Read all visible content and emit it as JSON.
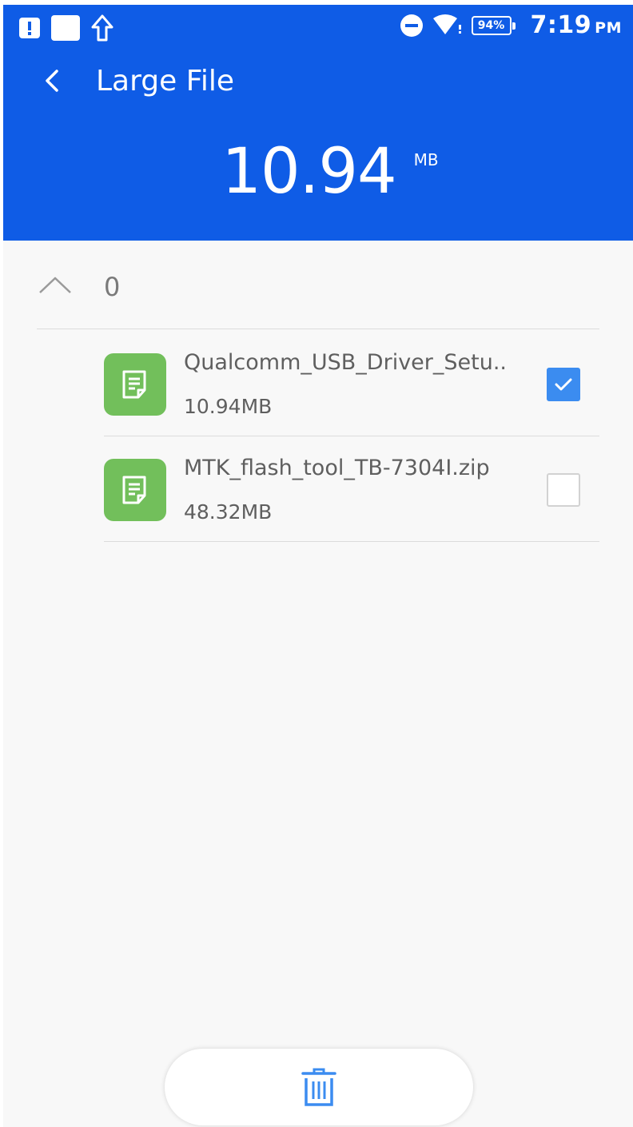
{
  "status_bar": {
    "battery": "94%",
    "time": "7:19",
    "ampm": "PM",
    "icons": [
      "alert-icon",
      "square-icon",
      "upload-arrow-icon",
      "do-not-disturb-icon",
      "wifi-icon",
      "battery-icon"
    ]
  },
  "header": {
    "title": "Large File",
    "total_size": "10.94",
    "total_unit": "MB",
    "background_color": "#0f5ce6"
  },
  "group": {
    "count": "0",
    "expanded": true
  },
  "files": [
    {
      "name": "Qualcomm_USB_Driver_Setu..",
      "size": "10.94MB",
      "checked": true
    },
    {
      "name": "MTK_flash_tool_TB-7304I.zip",
      "size": "48.32MB",
      "checked": false
    }
  ],
  "actions": {
    "delete_icon": "trash-icon",
    "accent_color": "#3b8cf0"
  }
}
